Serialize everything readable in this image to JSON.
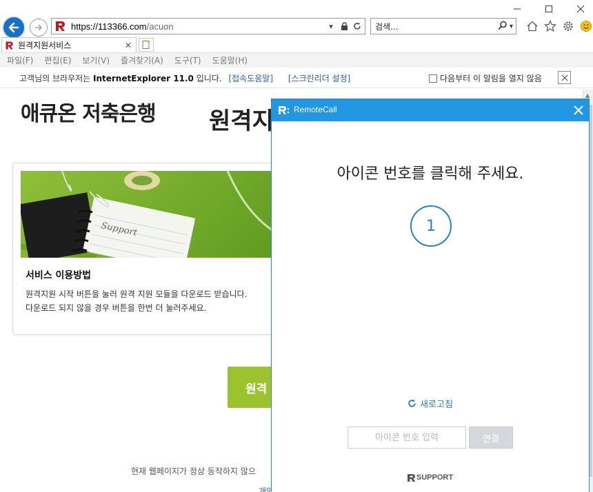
{
  "browser": {
    "address_url_host": "https://113366.com",
    "address_url_path": "/acuon",
    "search_placeholder": "검색...",
    "tab_title": "원격지원서비스",
    "menu": [
      "파일(F)",
      "편집(E)",
      "보기(V)",
      "즐겨찾기(A)",
      "도구(T)",
      "도움말(H)"
    ]
  },
  "infobar": {
    "message_prefix": "고객님의 브라우저는 ",
    "browser_name": "InternetExplorer 11.0",
    "message_suffix": " 입니다.",
    "help_link": "[접속도움말]",
    "reader_link": "[스크린리더 설정]",
    "dont_show": "다음부터 이 알림을 열지 않음"
  },
  "page": {
    "bank_name": "애큐온 저축은행",
    "heading": "원격지",
    "card_image_text": "Support",
    "card_title": "서비스 이용방법",
    "card_desc_1": "원격지원 시작 버튼을 눌러 원격 지원 모듈을 다운로드 받습니다.",
    "card_desc_2": "다운로드 되지 않을 경우 버튼을 한번 더 눌러주세요.",
    "start_button": "원격",
    "notice": "현재 웹페이지가 정상 동작하지 않으",
    "notice2": "개인"
  },
  "remotecall": {
    "title": "RemoteCall",
    "prompt": "아이콘 번호를 클릭해 주세요.",
    "icon_number": "1",
    "refresh": "새로고침",
    "code_placeholder": "아이콘 번호 입력",
    "connect": "연결",
    "brand": "SUPPORT"
  },
  "colors": {
    "accent": "#2196e3",
    "start_green": "#9cc22e",
    "link": "#2a5db0"
  }
}
